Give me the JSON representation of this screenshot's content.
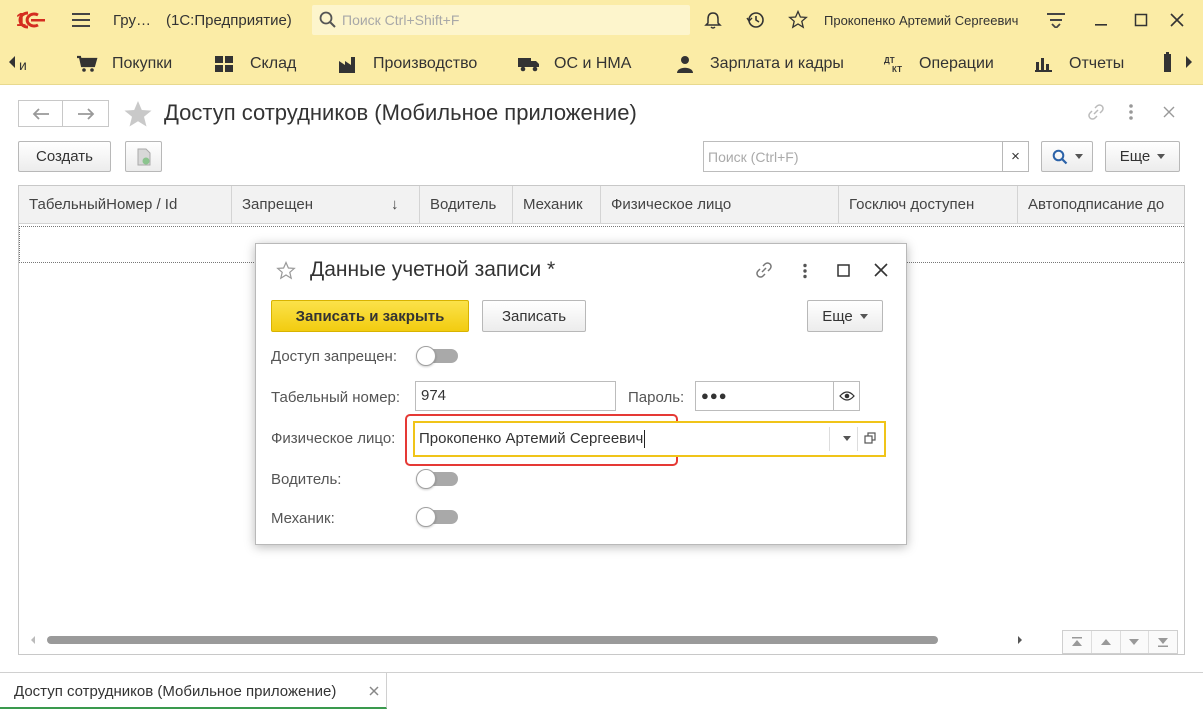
{
  "titlebar": {
    "group_label": "Гру…",
    "app_name": "(1С:Предприятие)",
    "search_placeholder": "Поиск Ctrl+Shift+F",
    "user_name": "Прокопенко Артемий Сергеевич"
  },
  "sections": {
    "cut_label": "и",
    "items": [
      {
        "label": "Покупки",
        "icon": "cart-icon"
      },
      {
        "label": "Склад",
        "icon": "warehouse-icon"
      },
      {
        "label": "Производство",
        "icon": "factory-icon"
      },
      {
        "label": "ОС и НМА",
        "icon": "truck-icon"
      },
      {
        "label": "Зарплата и кадры",
        "icon": "person-icon"
      },
      {
        "label": "Операции",
        "icon": "dt-kt-icon"
      },
      {
        "label": "Отчеты",
        "icon": "bar-chart-icon"
      }
    ]
  },
  "form": {
    "title": "Доступ сотрудников (Мобильное приложение)",
    "create_label": "Создать",
    "search_placeholder": "Поиск (Ctrl+F)",
    "clear_label": "×",
    "more_label": "Еще",
    "columns": [
      "ТабельныйНомер / Id",
      "Запрещен",
      "Водитель",
      "Механик",
      "Физическое лицо",
      "Госключ доступен",
      "Автоподписание до"
    ],
    "sort_indicator": "↓"
  },
  "dialog": {
    "title": "Данные учетной записи *",
    "save_close_label": "Записать и закрыть",
    "save_label": "Записать",
    "more_label": "Еще",
    "access_denied_label": "Доступ запрещен:",
    "tab_number_label": "Табельный номер:",
    "tab_number_value": "974",
    "password_label": "Пароль:",
    "password_value": "●●●",
    "person_label": "Физическое лицо:",
    "person_value": "Прокопенко Артемий Сергеевич",
    "driver_label": "Водитель:",
    "mechanic_label": "Механик:",
    "toggles": {
      "access_denied": false,
      "driver": false,
      "mechanic": false
    }
  },
  "bottom_tab": {
    "label": "Доступ сотрудников (Мобильное приложение)"
  },
  "colors": {
    "panel_yellow": "#fbeca6",
    "primary_button": "#f5d31c",
    "highlight_red": "#e53935",
    "focus_yellow": "#f0c419",
    "active_tab_green": "#3a9a4e"
  }
}
